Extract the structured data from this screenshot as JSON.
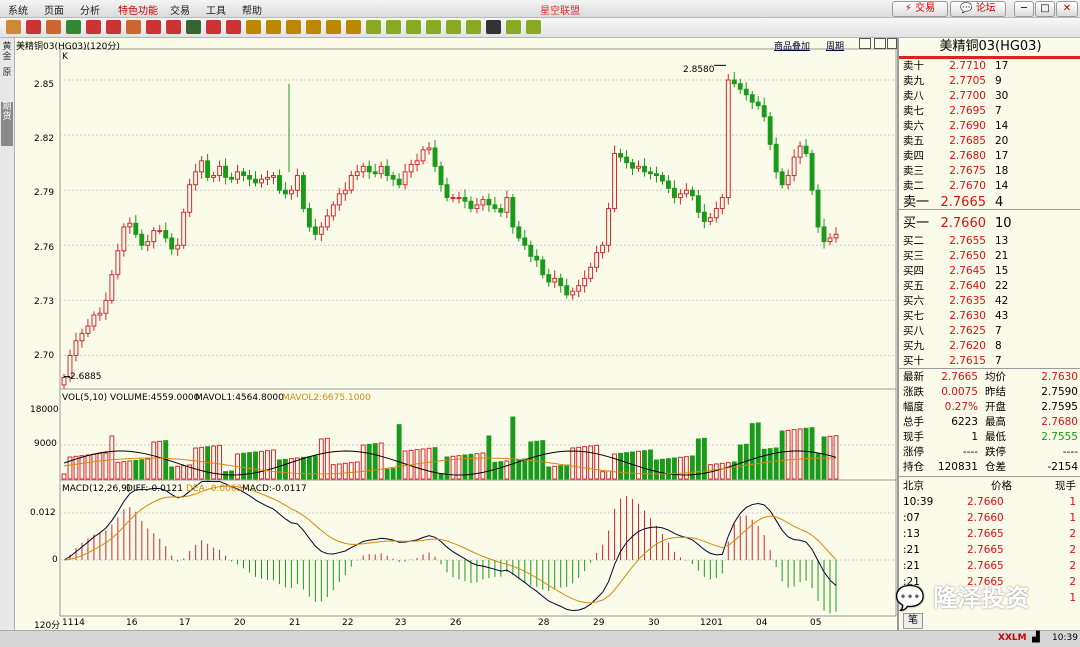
{
  "menu": {
    "items": [
      "系统",
      "页面",
      "分析",
      "特色功能",
      "交易",
      "工具",
      "帮助"
    ],
    "app_title": "星空联盟",
    "trade_button": "交易",
    "forum_button": "论坛"
  },
  "toolbar_labels": [
    "分",
    "分",
    "分",
    "时",
    "日",
    "周",
    "月",
    "年",
    "5",
    "15",
    "30",
    "60",
    "",
    "",
    ""
  ],
  "left_tabs": [
    "黄金",
    "原",
    "期货"
  ],
  "chart": {
    "symbol_label": "美精铜03(HG03)(120分)",
    "unit_label": "K",
    "link_overlay": "商品叠加",
    "link_period": "周期",
    "price_axis": [
      "2.85",
      "2.82",
      "2.79",
      "2.76",
      "2.73",
      "2.70"
    ],
    "high_label": "2.8580",
    "low_label": "2.6885",
    "vol_header": {
      "name": "VOL(5,10)",
      "volume": "VOLUME:4559.0000",
      "ma1": "MAVOL1:4564.8000",
      "ma2": "MAVOL2:6675.1000"
    },
    "vol_axis": [
      "18000",
      "9000"
    ],
    "macd_header": {
      "name": "MACD(12,26,9)",
      "diff": "DIFF:-0.0121",
      "dea": "DEA:-0.0063",
      "macd": "MACD:-0.0117"
    },
    "macd_axis": [
      "0.012",
      "0"
    ],
    "x_period": "120分",
    "x_labels": [
      "1114",
      "16",
      "17",
      "20",
      "21",
      "22",
      "23",
      "26",
      "28",
      "29",
      "30",
      "1201",
      "04",
      "05"
    ]
  },
  "chart_data": {
    "type": "candlestick",
    "symbol": "美精铜03(HG03)",
    "interval": "120分",
    "y_range": [
      2.685,
      2.862
    ],
    "high": 2.858,
    "low": 2.6885,
    "closes": [
      2.688,
      2.7,
      2.708,
      2.712,
      2.716,
      2.722,
      2.723,
      2.73,
      2.744,
      2.757,
      2.77,
      2.772,
      2.766,
      2.76,
      2.762,
      2.768,
      2.768,
      2.764,
      2.758,
      2.76,
      2.778,
      2.793,
      2.8,
      2.806,
      2.797,
      2.798,
      2.803,
      2.797,
      2.796,
      2.8,
      2.798,
      2.796,
      2.794,
      2.796,
      2.797,
      2.798,
      2.79,
      2.788,
      2.79,
      2.798,
      2.78,
      2.77,
      2.766,
      2.77,
      2.776,
      2.782,
      2.788,
      2.79,
      2.798,
      2.8,
      2.803,
      2.8,
      2.799,
      2.803,
      2.798,
      2.796,
      2.793,
      2.8,
      2.804,
      2.806,
      2.812,
      2.813,
      2.803,
      2.793,
      2.786,
      2.786,
      2.786,
      2.784,
      2.78,
      2.782,
      2.785,
      2.782,
      2.78,
      2.778,
      2.786,
      2.77,
      2.764,
      2.76,
      2.754,
      2.752,
      2.744,
      2.74,
      2.742,
      2.738,
      2.733,
      2.735,
      2.738,
      2.742,
      2.748,
      2.756,
      2.76,
      2.78,
      2.81,
      2.808,
      2.805,
      2.802,
      2.803,
      2.8,
      2.799,
      2.798,
      2.795,
      2.791,
      2.786,
      2.788,
      2.79,
      2.787,
      2.778,
      2.773,
      2.775,
      2.78,
      2.786,
      2.85,
      2.848,
      2.845,
      2.842,
      2.838,
      2.836,
      2.83,
      2.815,
      2.8,
      2.793,
      2.798,
      2.808,
      2.814,
      2.81,
      2.79,
      2.77,
      2.762,
      2.764,
      2.766
    ]
  },
  "order_book": {
    "title": "美精铜03(HG03)",
    "asks": [
      {
        "label": "卖十",
        "price": "2.7710",
        "qty": "17"
      },
      {
        "label": "卖九",
        "price": "2.7705",
        "qty": "9"
      },
      {
        "label": "卖八",
        "price": "2.7700",
        "qty": "30"
      },
      {
        "label": "卖七",
        "price": "2.7695",
        "qty": "7"
      },
      {
        "label": "卖六",
        "price": "2.7690",
        "qty": "14"
      },
      {
        "label": "卖五",
        "price": "2.7685",
        "qty": "20"
      },
      {
        "label": "卖四",
        "price": "2.7680",
        "qty": "17"
      },
      {
        "label": "卖三",
        "price": "2.7675",
        "qty": "18"
      },
      {
        "label": "卖二",
        "price": "2.7670",
        "qty": "14"
      },
      {
        "label": "卖一",
        "price": "2.7665",
        "qty": "4"
      }
    ],
    "bids": [
      {
        "label": "买一",
        "price": "2.7660",
        "qty": "10"
      },
      {
        "label": "买二",
        "price": "2.7655",
        "qty": "13"
      },
      {
        "label": "买三",
        "price": "2.7650",
        "qty": "21"
      },
      {
        "label": "买四",
        "price": "2.7645",
        "qty": "15"
      },
      {
        "label": "买五",
        "price": "2.7640",
        "qty": "22"
      },
      {
        "label": "买六",
        "price": "2.7635",
        "qty": "42"
      },
      {
        "label": "买七",
        "price": "2.7630",
        "qty": "43"
      },
      {
        "label": "买八",
        "price": "2.7625",
        "qty": "7"
      },
      {
        "label": "买九",
        "price": "2.7620",
        "qty": "8"
      },
      {
        "label": "买十",
        "price": "2.7615",
        "qty": "7"
      }
    ]
  },
  "stats": [
    {
      "l1": "最新",
      "v1": "2.7665",
      "l2": "均价",
      "v2": "2.7630"
    },
    {
      "l1": "涨跌",
      "v1": "0.0075",
      "l2": "昨结",
      "v2": "2.7590"
    },
    {
      "l1": "幅度",
      "v1": "0.27%",
      "l2": "开盘",
      "v2": "2.7595"
    },
    {
      "l1": "总手",
      "v1": "6223",
      "l2": "最高",
      "v2": "2.7680"
    },
    {
      "l1": "现手",
      "v1": "1",
      "l2": "最低",
      "v2": "2.7555"
    },
    {
      "l1": "涨停",
      "v1": "----",
      "l2": "跌停",
      "v2": "----"
    },
    {
      "l1": "持仓",
      "v1": "120831",
      "l2": "仓差",
      "v2": "-2154"
    }
  ],
  "ticks_header": {
    "time": "北京",
    "price": "价格",
    "qty": "现手"
  },
  "ticks": [
    {
      "time": "10:39",
      "price": "2.7660",
      "qty": "1"
    },
    {
      "time": ":07",
      "price": "2.7660",
      "qty": "1"
    },
    {
      "time": ":13",
      "price": "2.7665",
      "qty": "2"
    },
    {
      "time": ":21",
      "price": "2.7665",
      "qty": "2"
    },
    {
      "time": ":21",
      "price": "2.7665",
      "qty": "2"
    },
    {
      "time": ":21",
      "price": "2.7665",
      "qty": "2"
    },
    {
      "time": "",
      "price": "",
      "qty": "1"
    }
  ],
  "bottom_tab": "笔",
  "status": {
    "brand": "XXLM",
    "time": "10:39"
  },
  "watermark": "隆泽投资",
  "colors": {
    "up": "#d8262e",
    "down": "#1a9a1a",
    "panel_bg": "#fbfbe9",
    "accent": "#d22"
  }
}
